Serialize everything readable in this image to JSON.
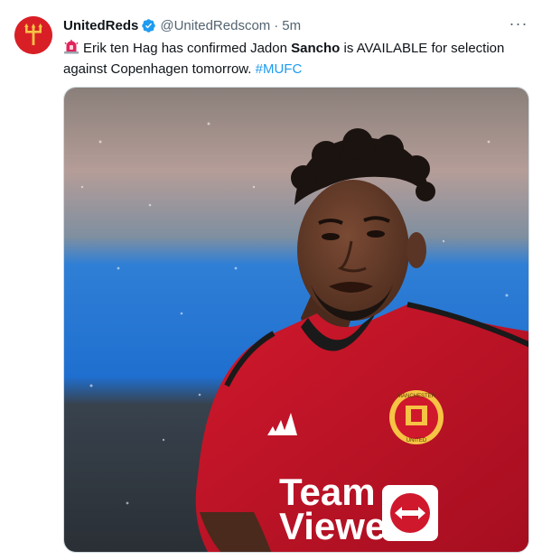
{
  "author": {
    "display_name": "UnitedReds",
    "handle": "@UnitedRedscom",
    "separator": "·",
    "time": "5m",
    "verified": true,
    "avatar_icon": "trident-crest-icon",
    "avatar_color": "#d91f26"
  },
  "more_menu": {
    "icon": "more-horizontal-icon",
    "label": "···"
  },
  "tweet": {
    "emoji": "siren-emoji",
    "text_part1": "Erik ten Hag has confirmed Jadon ",
    "text_bold": "Sancho",
    "text_part2": " is AVAILABLE for selection against Copenhagen tomorrow. ",
    "hashtag": "#MUFC"
  },
  "media": {
    "shirt_sponsor_line1": "Team",
    "shirt_sponsor_line2": "Viewer",
    "badge_top": "MANCHESTER",
    "badge_bottom": "UNITED"
  },
  "colors": {
    "link": "#1d9bf0",
    "secondary_text": "#536471",
    "verified": "#1d9bf0",
    "jersey_red": "#c8102e"
  }
}
